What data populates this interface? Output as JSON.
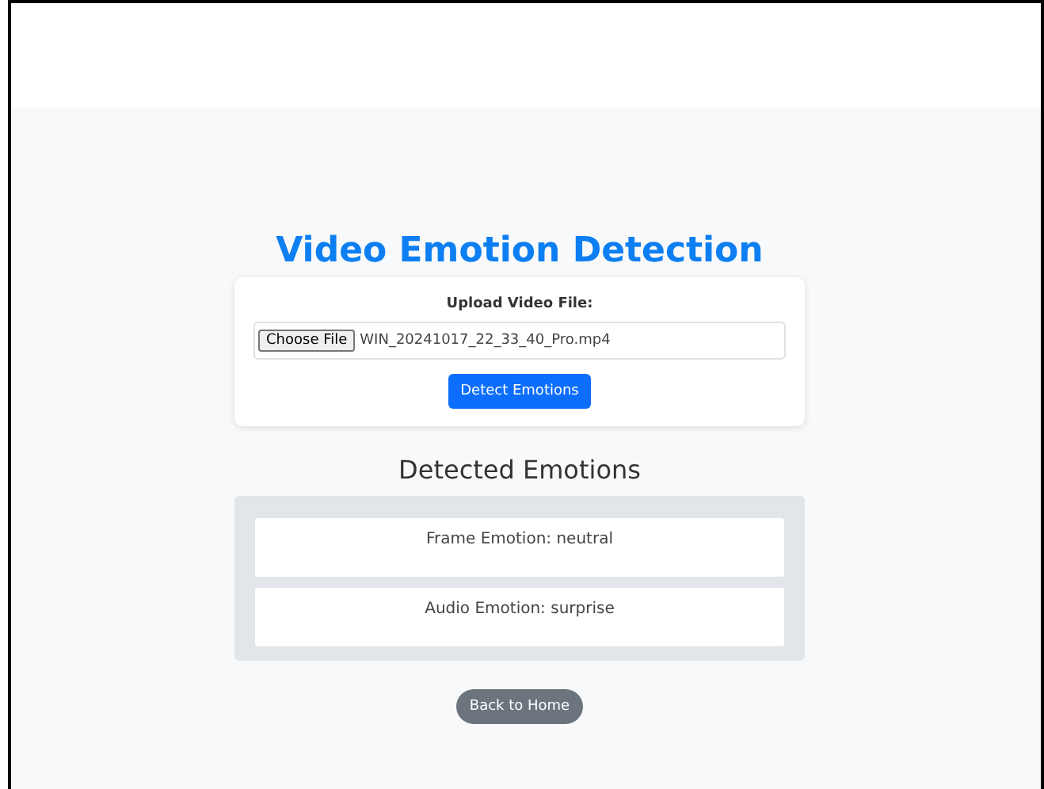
{
  "title": "Video Emotion Detection",
  "upload": {
    "label": "Upload Video File:",
    "choose_button": "Choose File",
    "file_name": "WIN_20241017_22_33_40_Pro.mp4",
    "submit_button": "Detect Emotions"
  },
  "results": {
    "heading": "Detected Emotions",
    "items": [
      "Frame Emotion: neutral",
      "Audio Emotion: surprise"
    ]
  },
  "back_button": "Back to Home"
}
